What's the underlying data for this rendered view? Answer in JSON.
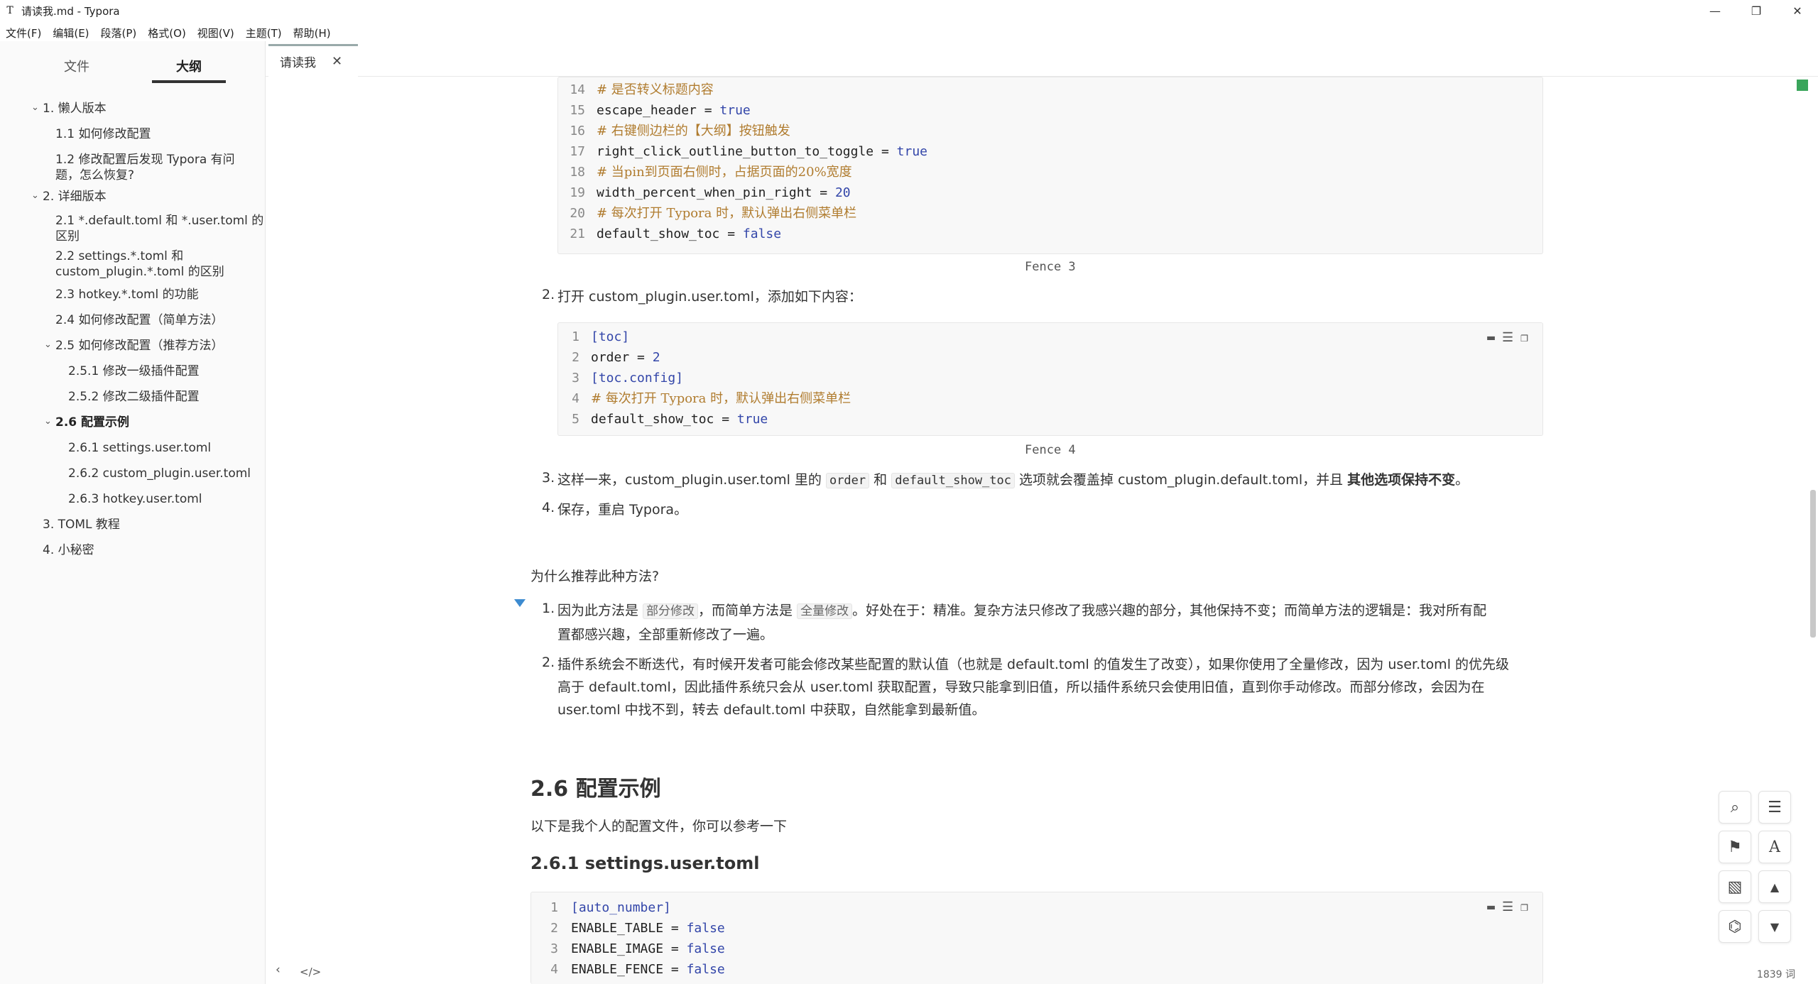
{
  "window": {
    "app_icon": "T",
    "title": "请读我.md - Typora",
    "controls": {
      "minimize": "—",
      "maximize": "❐",
      "close": "✕"
    }
  },
  "menu": [
    "文件(F)",
    "编辑(E)",
    "段落(P)",
    "格式(O)",
    "视图(V)",
    "主题(T)",
    "帮助(H)"
  ],
  "sidebar": {
    "tabs": {
      "files": "文件",
      "outline": "大纲"
    },
    "outline": [
      {
        "text": "1. 懒人版本",
        "chevron": "⌄"
      },
      {
        "text": "1.1 如何修改配置"
      },
      {
        "text": "1.2 修改配置后发现 Typora 有问",
        "text2": "题，怎么恢复?"
      },
      {
        "text": "2. 详细版本",
        "chevron": "⌄"
      },
      {
        "text": "2.1 *.default.toml 和 *.user.toml 的",
        "text2": "区别"
      },
      {
        "text": "2.2 settings.*.toml 和",
        "text2": "custom_plugin.*.toml 的区别"
      },
      {
        "text": "2.3 hotkey.*.toml 的功能"
      },
      {
        "text": "2.4 如何修改配置（简单方法）"
      },
      {
        "text": "2.5 如何修改配置（推荐方法）",
        "chevron": "⌄"
      },
      {
        "text": "2.5.1 修改一级插件配置"
      },
      {
        "text": "2.5.2 修改二级插件配置"
      },
      {
        "text": "2.6 配置示例",
        "chevron": "⌄"
      },
      {
        "text": "2.6.1 settings.user.toml"
      },
      {
        "text": "2.6.2 custom_plugin.user.toml"
      },
      {
        "text": "2.6.3 hotkey.user.toml"
      },
      {
        "text": "3. TOML 教程"
      },
      {
        "text": "4. 小秘密"
      }
    ]
  },
  "tab": {
    "label": "请读我",
    "close": "✕"
  },
  "doc": {
    "code1": {
      "lines": [
        {
          "n": "14",
          "t": "# 是否转义标题内容"
        },
        {
          "n": "15",
          "k": "escape_header = ",
          "v": "true"
        },
        {
          "n": "16",
          "t": "# 右键侧边栏的【大纲】按钮触发"
        },
        {
          "n": "17",
          "k": "right_click_outline_button_to_toggle = ",
          "v": "true"
        },
        {
          "n": "18",
          "t": "# 当pin到页面右侧时，占据页面的20%宽度"
        },
        {
          "n": "19",
          "k": "width_percent_when_pin_right = ",
          "v": "20"
        },
        {
          "n": "20",
          "t": "# 每次打开 Typora 时，默认弹出右侧菜单栏"
        },
        {
          "n": "21",
          "k": "default_show_toc = ",
          "v": "false"
        }
      ],
      "caption": "Fence 3"
    },
    "item2": {
      "num": "2.",
      "text": "打开 custom_plugin.user.toml，添加如下内容："
    },
    "code2": {
      "lines": [
        {
          "n": "1",
          "tbl": "[toc]"
        },
        {
          "n": "2",
          "k": "order = ",
          "v": "2"
        },
        {
          "n": "3",
          "tbl": "[toc.config]"
        },
        {
          "n": "4",
          "t": "# 每次打开 Typora 时，默认弹出右侧菜单栏"
        },
        {
          "n": "5",
          "k": "default_show_toc = ",
          "v": "true"
        }
      ],
      "caption": "Fence 4"
    },
    "item3": {
      "num": "3.",
      "a": "这样一来，custom_plugin.user.toml 里的 ",
      "code1": "order",
      "b": " 和 ",
      "code2": "default_show_toc",
      "c": " 选项就会覆盖掉 custom_plugin.default.toml，并且 ",
      "bold": "其他选项保持不变",
      "d": "。"
    },
    "item4": {
      "num": "4.",
      "text": "保存，重启 Typora。"
    },
    "why": "为什么推荐此种方法?",
    "reason1": {
      "num": "1.",
      "a": "因为此方法是 ",
      "tag1": "部分修改",
      "b": "，而简单方法是 ",
      "tag2": "全量修改",
      "c": "。好处在于：精准。复杂方法只修改了我感兴趣的部分，其他保持不变；而简单方法的逻辑是：我对所有配",
      "line2": "置都感兴趣，全部重新修改了一遍。"
    },
    "reason2": {
      "num": "2.",
      "line1": "插件系统会不断迭代，有时候开发者可能会修改某些配置的默认值（也就是 default.toml 的值发生了改变），如果你使用了全量修改，因为 user.toml 的优先级",
      "line2": "高于 default.toml，因此插件系统只会从 user.toml 获取配置，导致只能拿到旧值，所以插件系统只会使用旧值，直到你手动修改。而部分修改，会因为在",
      "line3": "user.toml 中找不到，转去 default.toml 中获取，自然能拿到最新值。"
    },
    "h2": "2.6 配置示例",
    "intro": "以下是我个人的配置文件，你可以参考一下",
    "h3": "2.6.1 settings.user.toml",
    "code3": {
      "lines": [
        {
          "n": "1",
          "tbl": "[auto_number]"
        },
        {
          "n": "2",
          "k": "ENABLE_TABLE = ",
          "v": "false"
        },
        {
          "n": "3",
          "k": "ENABLE_IMAGE = ",
          "v": "false"
        },
        {
          "n": "4",
          "k": "ENABLE_FENCE = ",
          "v": "false"
        }
      ]
    },
    "code_tools": {
      "collapse": "▬",
      "indent": "☰",
      "copy": "❐"
    }
  },
  "tools": {
    "search": "⌕",
    "outline": "☰",
    "bookmark": "⚑",
    "font": "A",
    "image": "▧",
    "up": "▲",
    "tree": "⌬",
    "down": "▼"
  },
  "status": {
    "back": "‹",
    "source": "</>",
    "word_count": "1839 词"
  },
  "colors": {
    "comment": "#b07c2f",
    "keyword_value": "#3346a9",
    "marker_green": "#3aa55b",
    "fold_triangle": "#3d8bd0"
  }
}
